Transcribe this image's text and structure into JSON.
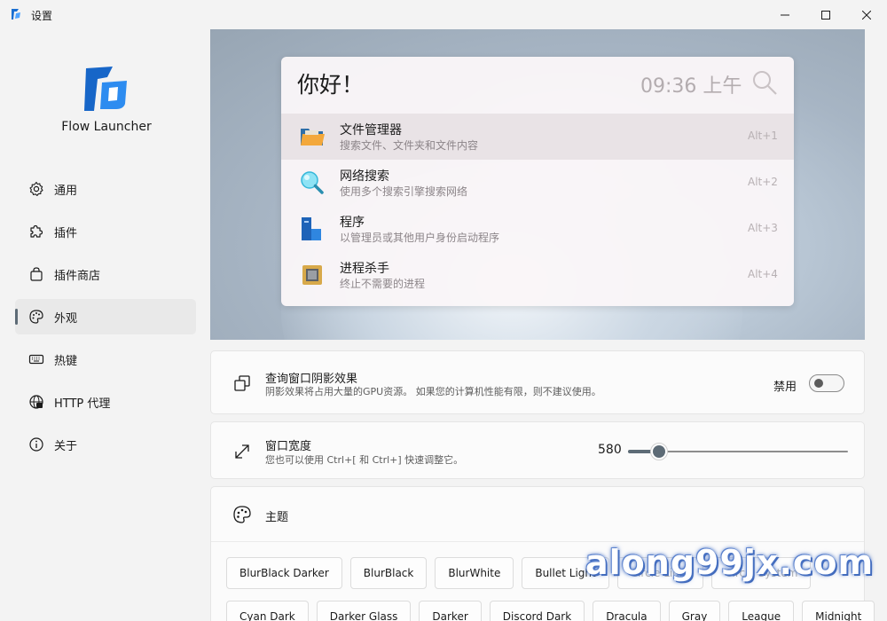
{
  "window": {
    "title": "设置",
    "minimize": "—",
    "maximize": "☐",
    "close": "✕"
  },
  "brand": {
    "name": "Flow Launcher",
    "accent": "#1a6fd1"
  },
  "sidebar": {
    "items": [
      {
        "label": "通用",
        "icon": "gear-icon"
      },
      {
        "label": "插件",
        "icon": "puzzle-icon"
      },
      {
        "label": "插件商店",
        "icon": "shopping-bag-icon"
      },
      {
        "label": "外观",
        "icon": "palette-icon",
        "active": true
      },
      {
        "label": "热键",
        "icon": "keyboard-icon"
      },
      {
        "label": "HTTP 代理",
        "icon": "globe-icon"
      },
      {
        "label": "关于",
        "icon": "info-icon"
      }
    ]
  },
  "preview": {
    "query": "你好！",
    "clock": "09:36 上午",
    "results": [
      {
        "title": "文件管理器",
        "subtitle": "搜索文件、文件夹和文件内容",
        "hotkey": "Alt+1",
        "icon": "folder-icon",
        "selected": true
      },
      {
        "title": "网络搜索",
        "subtitle": "使用多个搜索引擎搜索网络",
        "hotkey": "Alt+2",
        "icon": "magnifier-icon"
      },
      {
        "title": "程序",
        "subtitle": "以管理员或其他用户身份启动程序",
        "hotkey": "Alt+3",
        "icon": "program-icon"
      },
      {
        "title": "进程杀手",
        "subtitle": "终止不需要的进程",
        "hotkey": "Alt+4",
        "icon": "cpu-icon"
      }
    ]
  },
  "shadow_setting": {
    "title": "查询窗口阴影效果",
    "desc": "阴影效果将占用大量的GPU资源。 如果您的计算机性能有限，则不建议使用。",
    "state_label": "禁用",
    "enabled": false
  },
  "width_setting": {
    "title": "窗口宽度",
    "desc": "您也可以使用 Ctrl+[ 和 Ctrl+] 快速调整它。",
    "value": "580",
    "fraction": 0.14
  },
  "theme_setting": {
    "title": "主题",
    "row1": [
      "BlurBlack Darker",
      "BlurBlack",
      "BlurWhite",
      "Bullet Light",
      "Circle Light",
      "Circle System"
    ],
    "row2": [
      "Cyan Dark",
      "Darker Glass",
      "Darker",
      "Discord Dark",
      "Dracula",
      "Gray",
      "League",
      "Midnight"
    ]
  },
  "watermark": "along99jx.com"
}
